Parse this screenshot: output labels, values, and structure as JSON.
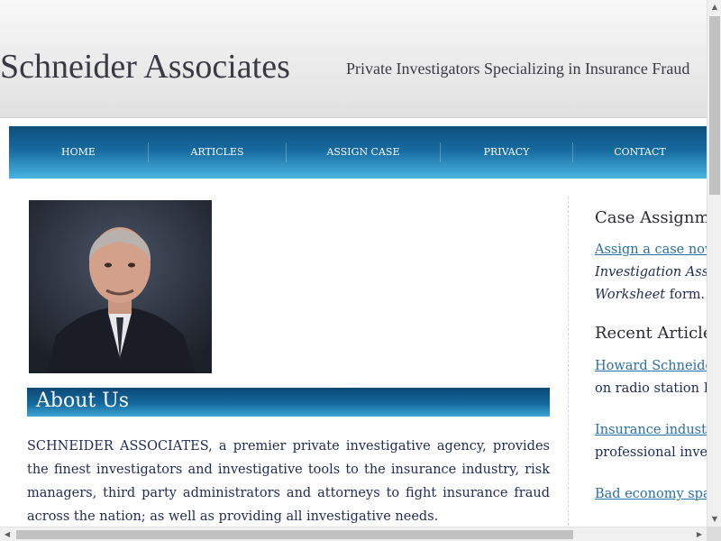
{
  "header": {
    "site_title": "Schneider Associates",
    "tagline": "Private Investigators Specializing in Insurance Fraud"
  },
  "nav": {
    "items": [
      {
        "label": "HOME"
      },
      {
        "label": "ARTICLES"
      },
      {
        "label": "ASSIGN CASE"
      },
      {
        "label": "PRIVACY"
      },
      {
        "label": "CONTACT"
      }
    ]
  },
  "main": {
    "about_heading": "About Us",
    "about_text": "SCHNEIDER ASSOCIATES, a premier private investigative agency, provides the finest investigators and investigative tools to the insurance industry, risk managers, third party administrators and attorneys to fight insurance fraud across the nation; as well as providing all investigative needs."
  },
  "sidebar": {
    "case_heading": "Case Assignm",
    "case_link": "Assign a case now",
    "case_line2": "Investigation Ass",
    "case_line3_italic": "Worksheet",
    "case_line3_rest": " form.",
    "articles_heading": "Recent Article",
    "articles": [
      {
        "link": "Howard Schneide",
        "rest": "on radio station K"
      },
      {
        "link": "Insurance industr",
        "rest": "professional inves"
      },
      {
        "link": "Bad economy spa",
        "rest": ""
      }
    ]
  },
  "colors": {
    "nav_dark": "#0e4f7c",
    "nav_light": "#4ab4e0",
    "link": "#2a6fa8",
    "body_text": "#1f2a5a"
  }
}
